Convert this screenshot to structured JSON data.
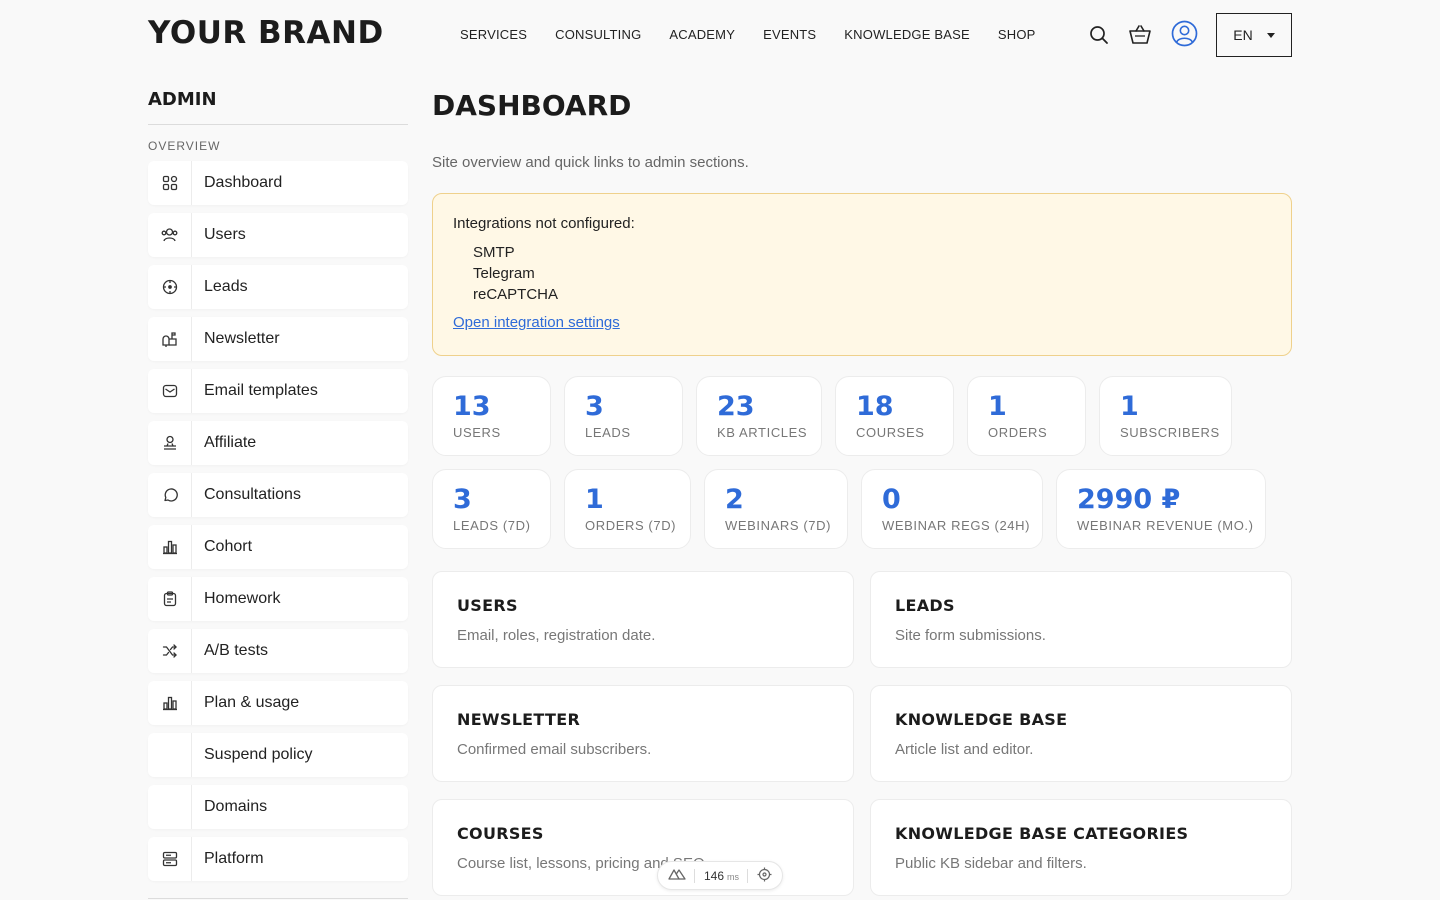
{
  "brand": "YOUR BRAND",
  "nav": [
    "SERVICES",
    "CONSULTING",
    "ACADEMY",
    "EVENTS",
    "KNOWLEDGE BASE",
    "SHOP"
  ],
  "header": {
    "lang": "EN"
  },
  "sidebar": {
    "title": "ADMIN",
    "section": "OVERVIEW",
    "items": [
      {
        "label": "Dashboard",
        "icon": "grid-icon"
      },
      {
        "label": "Users",
        "icon": "users-icon"
      },
      {
        "label": "Leads",
        "icon": "target-icon"
      },
      {
        "label": "Newsletter",
        "icon": "mailbox-icon"
      },
      {
        "label": "Email templates",
        "icon": "envelope-icon"
      },
      {
        "label": "Affiliate",
        "icon": "affiliate-icon"
      },
      {
        "label": "Consultations",
        "icon": "chat-icon"
      },
      {
        "label": "Cohort",
        "icon": "bar-chart-icon"
      },
      {
        "label": "Homework",
        "icon": "clipboard-icon"
      },
      {
        "label": "A/B tests",
        "icon": "shuffle-icon"
      },
      {
        "label": "Plan & usage",
        "icon": "bar-chart-icon"
      },
      {
        "label": "Suspend policy",
        "icon": ""
      },
      {
        "label": "Domains",
        "icon": ""
      },
      {
        "label": "Platform",
        "icon": "server-icon"
      }
    ]
  },
  "main": {
    "title": "DASHBOARD",
    "subtitle": "Site overview and quick links to admin sections.",
    "alert": {
      "title": "Integrations not configured:",
      "items": [
        "SMTP",
        "Telegram",
        "reCAPTCHA"
      ],
      "link": "Open integration settings"
    },
    "stats_row1": [
      {
        "value": "13",
        "label": "USERS"
      },
      {
        "value": "3",
        "label": "LEADS"
      },
      {
        "value": "23",
        "label": "KB ARTICLES"
      },
      {
        "value": "18",
        "label": "COURSES"
      },
      {
        "value": "1",
        "label": "ORDERS"
      },
      {
        "value": "1",
        "label": "SUBSCRIBERS"
      }
    ],
    "stats_row2": [
      {
        "value": "3",
        "label": "LEADS (7D)"
      },
      {
        "value": "1",
        "label": "ORDERS (7D)"
      },
      {
        "value": "2",
        "label": "WEBINARS (7D)"
      },
      {
        "value": "0",
        "label": "WEBINAR REGS (24H)"
      },
      {
        "value": "2990 ₽",
        "label": "WEBINAR REVENUE (MO.)"
      }
    ],
    "cards": [
      {
        "title": "USERS",
        "desc": "Email, roles, registration date."
      },
      {
        "title": "LEADS",
        "desc": "Site form submissions."
      },
      {
        "title": "NEWSLETTER",
        "desc": "Confirmed email subscribers."
      },
      {
        "title": "KNOWLEDGE BASE",
        "desc": "Article list and editor."
      },
      {
        "title": "COURSES",
        "desc": "Course list, lessons, pricing and SEO."
      },
      {
        "title": "KNOWLEDGE BASE CATEGORIES",
        "desc": "Public KB sidebar and filters."
      }
    ]
  },
  "perf": {
    "value": "146",
    "unit": "ms"
  },
  "colors": {
    "accent": "#2f6bd8",
    "alert_bg": "#fff8e6",
    "alert_border": "#efd18c"
  }
}
